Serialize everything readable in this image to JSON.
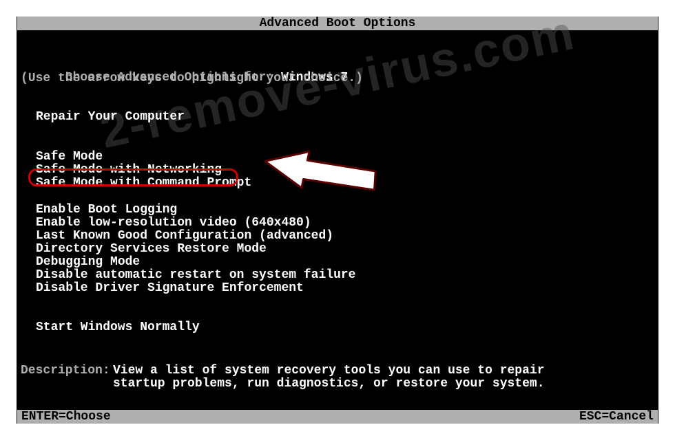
{
  "title": "Advanced Boot Options",
  "intro1a": "Choose Advanced Options for: ",
  "intro1b": "Windows 7",
  "intro2": "(Use the arrow keys to highlight your choice.)",
  "items": {
    "repair": "Repair Your Computer",
    "safe": "Safe Mode",
    "safenet": "Safe Mode with Networking",
    "safecmd": "Safe Mode with Command Prompt",
    "bootlog": "Enable Boot Logging",
    "lowres": "Enable low-resolution video (640x480)",
    "lastknown": "Last Known Good Configuration (advanced)",
    "dsrm": "Directory Services Restore Mode",
    "debug": "Debugging Mode",
    "noreboot": "Disable automatic restart on system failure",
    "nosig": "Disable Driver Signature Enforcement",
    "normal": "Start Windows Normally"
  },
  "desc": {
    "label": "Description:",
    "l1": "View a list of system recovery tools you can use to repair",
    "l2": "startup problems, run diagnostics, or restore your system."
  },
  "footer": {
    "left": "ENTER=Choose",
    "right": "ESC=Cancel"
  },
  "watermark": "2-remove-virus.com"
}
